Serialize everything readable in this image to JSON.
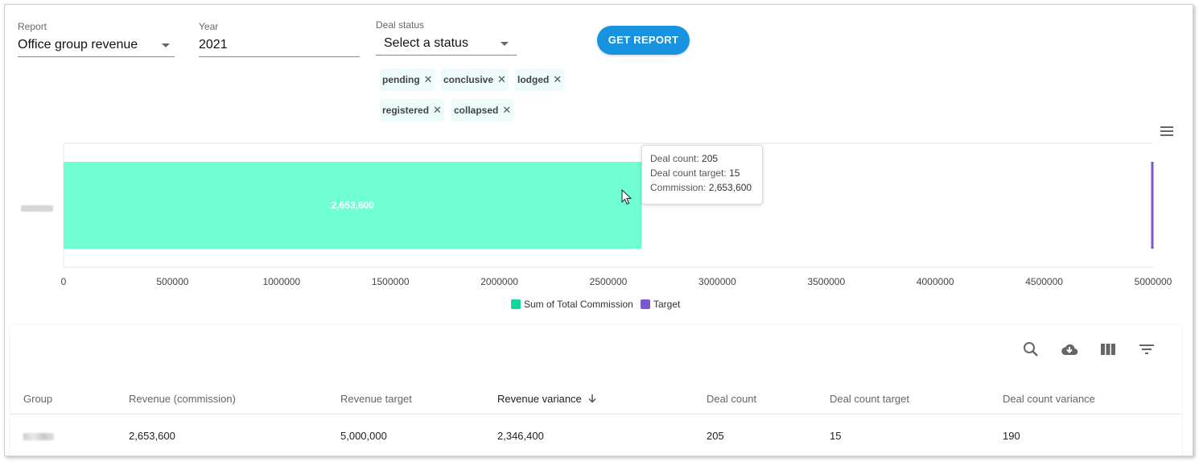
{
  "filters": {
    "report_label": "Report",
    "report_value": "Office group revenue",
    "year_label": "Year",
    "year_value": "2021",
    "status_label": "Deal status",
    "status_placeholder": "Select a status",
    "chips": [
      "pending",
      "conclusive",
      "lodged",
      "registered",
      "collapsed"
    ],
    "chip_remove_icon": "close-icon",
    "get_report_label": "GET REPORT"
  },
  "chart_data": {
    "type": "bar",
    "orientation": "horizontal",
    "categories": [
      "[redacted group]"
    ],
    "series": [
      {
        "name": "Sum of Total Commission",
        "values": [
          2653600
        ],
        "color": "#6fffd2"
      },
      {
        "name": "Target",
        "values": [
          5000000
        ],
        "color": "#7b57d0",
        "style": "target-marker"
      }
    ],
    "bar_label": "2,653,600",
    "xlim": [
      0,
      5000000
    ],
    "xticks": [
      "0",
      "500000",
      "1000000",
      "1500000",
      "2000000",
      "2500000",
      "3000000",
      "3500000",
      "4000000",
      "4500000",
      "5000000"
    ],
    "legend": [
      "Sum of Total Commission",
      "Target"
    ],
    "legend_position": "bottom-center",
    "legend_colors": [
      "#12d6a0",
      "#7b57d0"
    ],
    "menu_icon": "menu-icon"
  },
  "tooltip": {
    "deal_count_label": "Deal count:",
    "deal_count_value": "205",
    "deal_target_label": "Deal count target:",
    "deal_target_value": "15",
    "commission_label": "Commission:",
    "commission_value": "2,653,600"
  },
  "table": {
    "toolbar_icons": [
      "search-icon",
      "cloud-download-icon",
      "view-column-icon",
      "filter-list-icon"
    ],
    "columns": [
      "Group",
      "Revenue (commission)",
      "Revenue target",
      "Revenue variance",
      "Deal count",
      "Deal count target",
      "Deal count variance"
    ],
    "sort_icon": "arrow-down-icon",
    "rows": [
      {
        "group": "",
        "revenue": "2,653,600",
        "target": "5,000,000",
        "variance": "2,346,400",
        "deal_count": "205",
        "deal_target": "15",
        "deal_variance": "190"
      }
    ]
  },
  "colors": {
    "accent": "#1793e0",
    "bar": "#6fffd2",
    "target": "#7b57d0"
  }
}
